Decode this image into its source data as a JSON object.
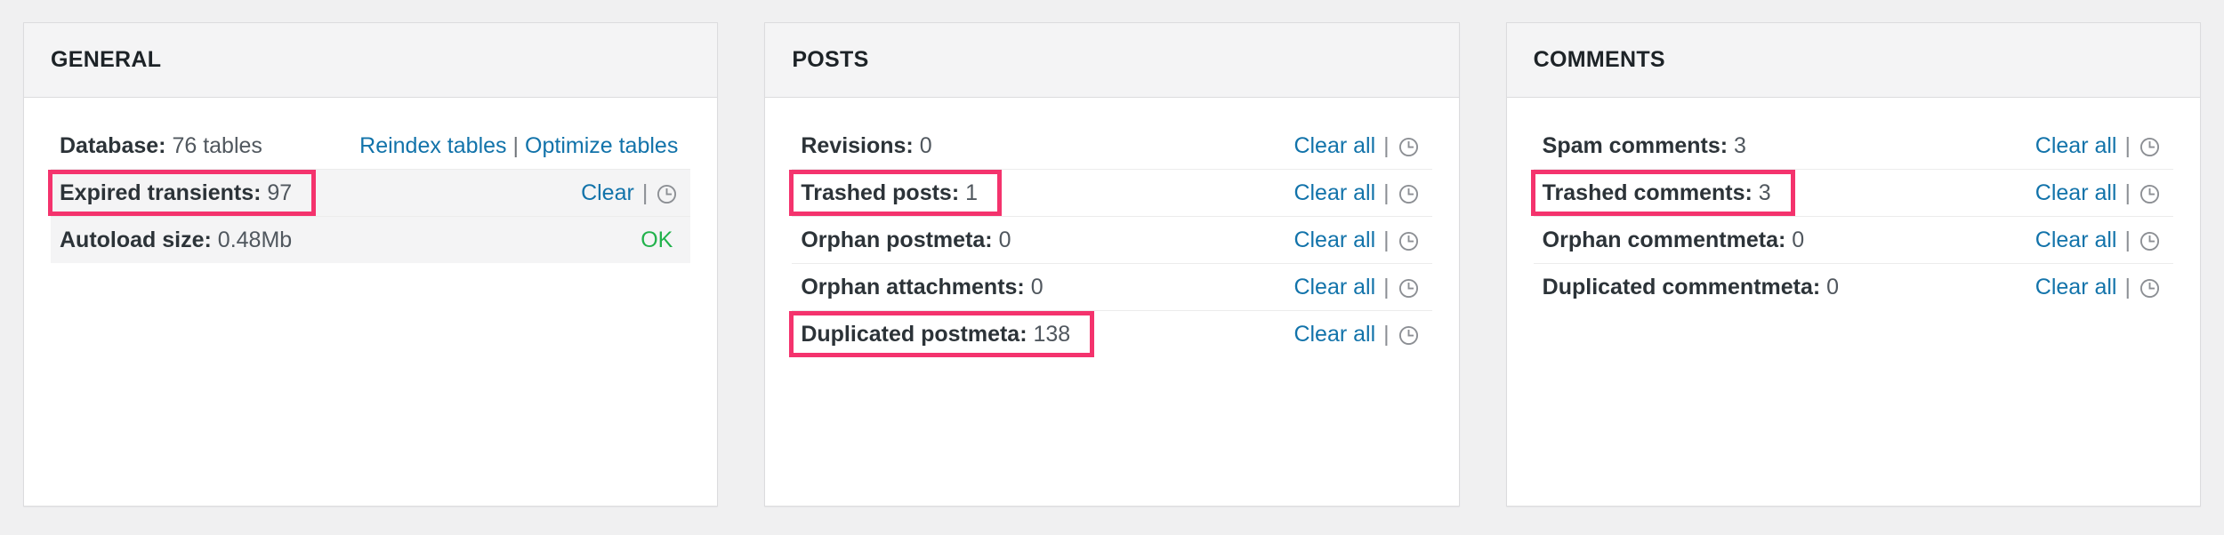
{
  "colors": {
    "accent_highlight": "#f4336d",
    "link": "#1273aa",
    "ok_green": "#22b24c",
    "panel_header_bg": "#f4f4f5",
    "row_shaded_bg": "#f4f4f5",
    "page_bg": "#f0f0f1",
    "border": "#dcdcde"
  },
  "icons": {
    "schedule": "clock-icon"
  },
  "panels": [
    {
      "id": "general",
      "title": "GENERAL",
      "rows": [
        {
          "key": "Database:",
          "value": "76 tables",
          "shaded": false,
          "highlight": false,
          "actions": {
            "type": "links",
            "links": [
              "Reindex tables",
              "Optimize tables"
            ],
            "separator": "|"
          }
        },
        {
          "key": "Expired transients:",
          "value": "97",
          "shaded": true,
          "highlight": true,
          "actions": {
            "type": "clear",
            "clear_label": "Clear",
            "separator": "|",
            "schedule_icon": "clock-icon"
          }
        },
        {
          "key": "Autoload size:",
          "value": "0.48Mb",
          "shaded": true,
          "highlight": false,
          "actions": {
            "type": "status",
            "status_label": "OK"
          }
        }
      ]
    },
    {
      "id": "posts",
      "title": "POSTS",
      "rows": [
        {
          "key": "Revisions:",
          "value": "0",
          "shaded": false,
          "highlight": false,
          "actions": {
            "type": "clear",
            "clear_label": "Clear all",
            "separator": "|",
            "schedule_icon": "clock-icon"
          }
        },
        {
          "key": "Trashed posts:",
          "value": "1",
          "shaded": false,
          "highlight": true,
          "actions": {
            "type": "clear",
            "clear_label": "Clear all",
            "separator": "|",
            "schedule_icon": "clock-icon"
          }
        },
        {
          "key": "Orphan postmeta:",
          "value": "0",
          "shaded": false,
          "highlight": false,
          "actions": {
            "type": "clear",
            "clear_label": "Clear all",
            "separator": "|",
            "schedule_icon": "clock-icon"
          }
        },
        {
          "key": "Orphan attachments:",
          "value": "0",
          "shaded": false,
          "highlight": false,
          "actions": {
            "type": "clear",
            "clear_label": "Clear all",
            "separator": "|",
            "schedule_icon": "clock-icon"
          }
        },
        {
          "key": "Duplicated postmeta:",
          "value": "138",
          "shaded": false,
          "highlight": true,
          "actions": {
            "type": "clear",
            "clear_label": "Clear all",
            "separator": "|",
            "schedule_icon": "clock-icon"
          }
        }
      ]
    },
    {
      "id": "comments",
      "title": "COMMENTS",
      "rows": [
        {
          "key": "Spam comments:",
          "value": "3",
          "shaded": false,
          "highlight": false,
          "actions": {
            "type": "clear",
            "clear_label": "Clear all",
            "separator": "|",
            "schedule_icon": "clock-icon"
          }
        },
        {
          "key": "Trashed comments:",
          "value": "3",
          "shaded": false,
          "highlight": true,
          "actions": {
            "type": "clear",
            "clear_label": "Clear all",
            "separator": "|",
            "schedule_icon": "clock-icon"
          }
        },
        {
          "key": "Orphan commentmeta:",
          "value": "0",
          "shaded": false,
          "highlight": false,
          "actions": {
            "type": "clear",
            "clear_label": "Clear all",
            "separator": "|",
            "schedule_icon": "clock-icon"
          }
        },
        {
          "key": "Duplicated commentmeta:",
          "value": "0",
          "shaded": false,
          "highlight": false,
          "actions": {
            "type": "clear",
            "clear_label": "Clear all",
            "separator": "|",
            "schedule_icon": "clock-icon"
          }
        }
      ]
    }
  ]
}
